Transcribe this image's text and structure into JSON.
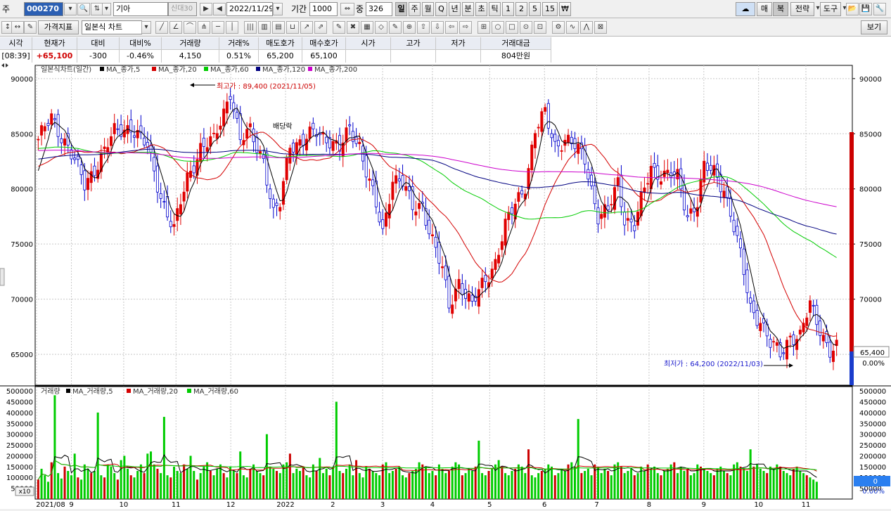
{
  "toolbar1": {
    "code_prefix": "주",
    "code": "000270",
    "name": "기아",
    "name_tags": "신대30",
    "date": "2022/11/29",
    "period_label": "기간",
    "period_value": "1000",
    "zoom_label": "중",
    "zoom_value": "326",
    "intervals": [
      "일",
      "주",
      "월",
      "Q",
      "년",
      "분",
      "초",
      "틱",
      "1",
      "2",
      "5",
      "15",
      "₩"
    ],
    "selected_interval": "일",
    "right_buttons": [
      "매",
      "복",
      "전략",
      "도구"
    ]
  },
  "toolbar2": {
    "price_indicator_label": "가격지표",
    "chart_type_value": "일본식 차트",
    "view_button": "보기"
  },
  "quote": {
    "headers": [
      "시각",
      "현재가",
      "대비",
      "대비%",
      "거래량",
      "거래%",
      "매도호가",
      "매수호가",
      "시가",
      "고가",
      "저가",
      "거래대금"
    ],
    "values": [
      "[08:39]",
      "+65,100",
      "-300",
      "-0.46%",
      "4,150",
      "0.51%",
      "65,200",
      "65,100",
      "",
      "",
      "",
      "804만원"
    ]
  },
  "chart": {
    "legend_price": "일본식차트(일간)",
    "ma_price_labels": [
      "MA_종가,5",
      "MA_종가,20",
      "MA_종가,60",
      "MA_종가,120",
      "MA_종가,200"
    ],
    "legend_volume": "거래량",
    "ma_volume_labels": [
      "MA_거래량,5",
      "MA_거래량,20",
      "MA_거래량,60"
    ],
    "high_note": "최고가 : 89,400 (2021/11/05)",
    "low_note": "최저가 : 64,200 (2022/11/03)",
    "dividend_note": "배당락",
    "current_price_tag": "65,400",
    "current_pct": "0.00%",
    "volume_current_tag": "0",
    "volume_pct": "0.00%",
    "volume_unit_tag": "x10",
    "colors": {
      "up": "#e00000",
      "down": "#0000cc",
      "ma5": "#000000",
      "ma20": "#d40000",
      "ma60": "#00cc00",
      "ma120": "#000080",
      "ma200": "#cc00cc",
      "vol_up": "#cc0000",
      "vol_down": "#00cc00"
    }
  },
  "chart_data": {
    "type": "candlestick",
    "price_axis_ticks": [
      "90000",
      "85000",
      "80000",
      "75000",
      "70000",
      "65000"
    ],
    "price_ylim": [
      62200,
      91200
    ],
    "volume_axis_ticks": [
      "500000",
      "450000",
      "400000",
      "350000",
      "300000",
      "250000",
      "200000",
      "150000",
      "100000",
      "50000"
    ],
    "x_tick_labels": [
      "2021/08",
      "9",
      "10",
      "11",
      "12",
      "2022",
      "2",
      "3",
      "4",
      "5",
      "6",
      "7",
      "8",
      "9",
      "10",
      "11"
    ],
    "trend_close": [
      [
        0,
        84500
      ],
      [
        4,
        86300
      ],
      [
        9,
        84000
      ],
      [
        14,
        80200
      ],
      [
        18,
        82500
      ],
      [
        23,
        85000
      ],
      [
        28,
        85800
      ],
      [
        33,
        83600
      ],
      [
        37,
        79500
      ],
      [
        41,
        76200
      ],
      [
        45,
        81000
      ],
      [
        49,
        83800
      ],
      [
        53,
        84200
      ],
      [
        58,
        89000
      ],
      [
        61,
        84200
      ],
      [
        64,
        85200
      ],
      [
        68,
        82800
      ],
      [
        71,
        77500
      ],
      [
        73,
        78500
      ],
      [
        76,
        84200
      ],
      [
        80,
        84300
      ],
      [
        84,
        85100
      ],
      [
        88,
        84600
      ],
      [
        91,
        83500
      ],
      [
        94,
        85300
      ],
      [
        97,
        84100
      ],
      [
        101,
        79500
      ],
      [
        104,
        75800
      ],
      [
        107,
        81200
      ],
      [
        110,
        80700
      ],
      [
        113,
        78000
      ],
      [
        116,
        78600
      ],
      [
        119,
        75500
      ],
      [
        122,
        72500
      ],
      [
        124,
        69200
      ],
      [
        127,
        71800
      ],
      [
        131,
        69300
      ],
      [
        134,
        71200
      ],
      [
        138,
        73500
      ],
      [
        141,
        76500
      ],
      [
        144,
        78600
      ],
      [
        147,
        80500
      ],
      [
        150,
        85200
      ],
      [
        153,
        86700
      ],
      [
        156,
        84100
      ],
      [
        159,
        84500
      ],
      [
        162,
        83700
      ],
      [
        165,
        82800
      ],
      [
        167,
        80200
      ],
      [
        169,
        77500
      ],
      [
        172,
        77800
      ],
      [
        175,
        80700
      ],
      [
        177,
        77500
      ],
      [
        180,
        76600
      ],
      [
        183,
        79800
      ],
      [
        185,
        82000
      ],
      [
        188,
        81400
      ],
      [
        191,
        81200
      ],
      [
        193,
        80900
      ],
      [
        196,
        77700
      ],
      [
        199,
        78900
      ],
      [
        201,
        81800
      ],
      [
        204,
        81500
      ],
      [
        207,
        80200
      ],
      [
        209,
        77800
      ],
      [
        212,
        73800
      ],
      [
        215,
        69300
      ],
      [
        218,
        68200
      ],
      [
        221,
        65800
      ],
      [
        224,
        65000
      ],
      [
        227,
        66800
      ],
      [
        230,
        66500
      ],
      [
        233,
        69400
      ],
      [
        236,
        67500
      ],
      [
        239,
        65300
      ],
      [
        241,
        65400
      ]
    ],
    "volume_bars": [
      90000,
      140000,
      110000,
      80000,
      170000,
      480000,
      120000,
      95000,
      150000,
      130000,
      110000,
      210000,
      100000,
      90000,
      160000,
      140000,
      120000,
      130000,
      400000,
      110000,
      100000,
      160000,
      150000,
      120000,
      90000,
      180000,
      200000,
      140000,
      110000,
      100000,
      130000,
      160000,
      120000,
      210000,
      220000,
      160000,
      140000,
      120000,
      380000,
      110000,
      100000,
      150000,
      130000,
      120000,
      160000,
      140000,
      200000,
      130000,
      90000,
      120000,
      150000,
      170000,
      130000,
      110000,
      140000,
      160000,
      120000,
      100000,
      150000,
      130000,
      120000,
      220000,
      110000,
      100000,
      140000,
      160000,
      130000,
      120000,
      110000,
      300000,
      150000,
      140000,
      130000,
      120000,
      160000,
      170000,
      210000,
      120000,
      140000,
      130000,
      150000,
      110000,
      100000,
      160000,
      130000,
      190000,
      120000,
      140000,
      110000,
      150000,
      450000,
      130000,
      120000,
      140000,
      160000,
      110000,
      180000,
      120000,
      100000,
      150000,
      140000,
      130000,
      120000,
      110000,
      160000,
      170000,
      120000,
      130000,
      140000,
      150000,
      110000,
      100000,
      120000,
      130000,
      140000,
      170000,
      160000,
      150000,
      120000,
      130000,
      110000,
      160000,
      140000,
      120000,
      130000,
      150000,
      170000,
      160000,
      110000,
      120000,
      140000,
      130000,
      150000,
      270000,
      120000,
      110000,
      130000,
      140000,
      160000,
      180000,
      150000,
      120000,
      110000,
      130000,
      140000,
      160000,
      150000,
      120000,
      230000,
      110000,
      100000,
      120000,
      130000,
      140000,
      160000,
      150000,
      110000,
      120000,
      140000,
      130000,
      160000,
      170000,
      150000,
      370000,
      120000,
      130000,
      140000,
      110000,
      160000,
      150000,
      120000,
      140000,
      130000,
      110000,
      160000,
      170000,
      150000,
      120000,
      130000,
      140000,
      110000,
      120000,
      150000,
      130000,
      160000,
      140000,
      150000,
      120000,
      110000,
      130000,
      140000,
      160000,
      170000,
      120000,
      150000,
      130000,
      140000,
      110000,
      120000,
      160000,
      150000,
      140000,
      130000,
      120000,
      110000,
      140000,
      150000,
      130000,
      120000,
      110000,
      160000,
      170000,
      150000,
      140000,
      130000,
      230000,
      150000,
      160000,
      140000,
      130000,
      120000,
      150000,
      140000,
      160000,
      150000,
      130000,
      120000,
      110000,
      140000,
      150000,
      130000,
      120000,
      110000,
      100000,
      90000,
      80000
    ],
    "annotations": [
      "최고가 : 89,400 (2021/11/05)",
      "최저가 : 64,200 (2022/11/03)",
      "배당락"
    ]
  }
}
